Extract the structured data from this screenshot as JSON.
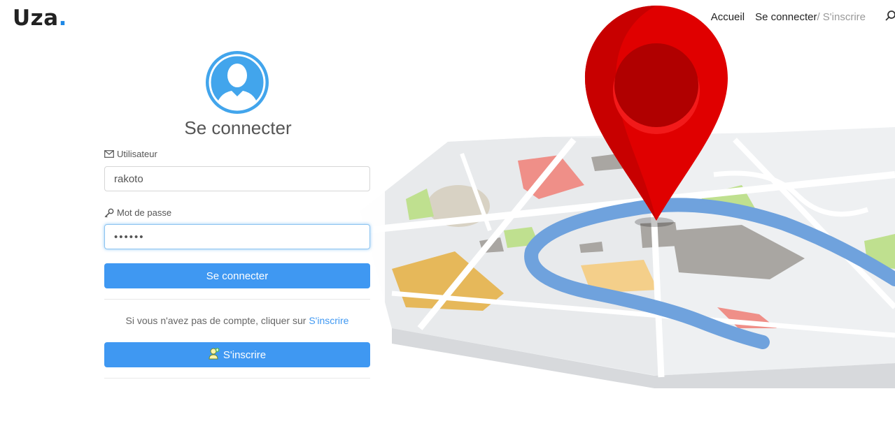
{
  "brand": {
    "name": "Uza",
    "dot": "."
  },
  "nav": {
    "home": "Accueil",
    "login": "Se connecter",
    "signup": "/ S'inscrire",
    "search_icon": "search-icon"
  },
  "login_form": {
    "title": "Se connecter",
    "avatar_icon": "user-avatar-icon",
    "username_label": "Utilisateur",
    "username_icon": "envelope-icon",
    "username_value": "rakoto",
    "password_label": "Mot de passe",
    "password_icon": "key-icon",
    "password_value": "••••••",
    "submit_label": "Se connecter",
    "signup_prompt": "Si vous n'avez pas de compte, cliquer sur",
    "signup_link": "S'inscrire",
    "signup_button_label": "S'inscrire",
    "signup_button_icon": "person-add-icon"
  },
  "colors": {
    "accent": "#3f98f2",
    "brand_dot": "#1e88e5",
    "pin_red": "#e00000",
    "river": "#6fa2dd"
  }
}
